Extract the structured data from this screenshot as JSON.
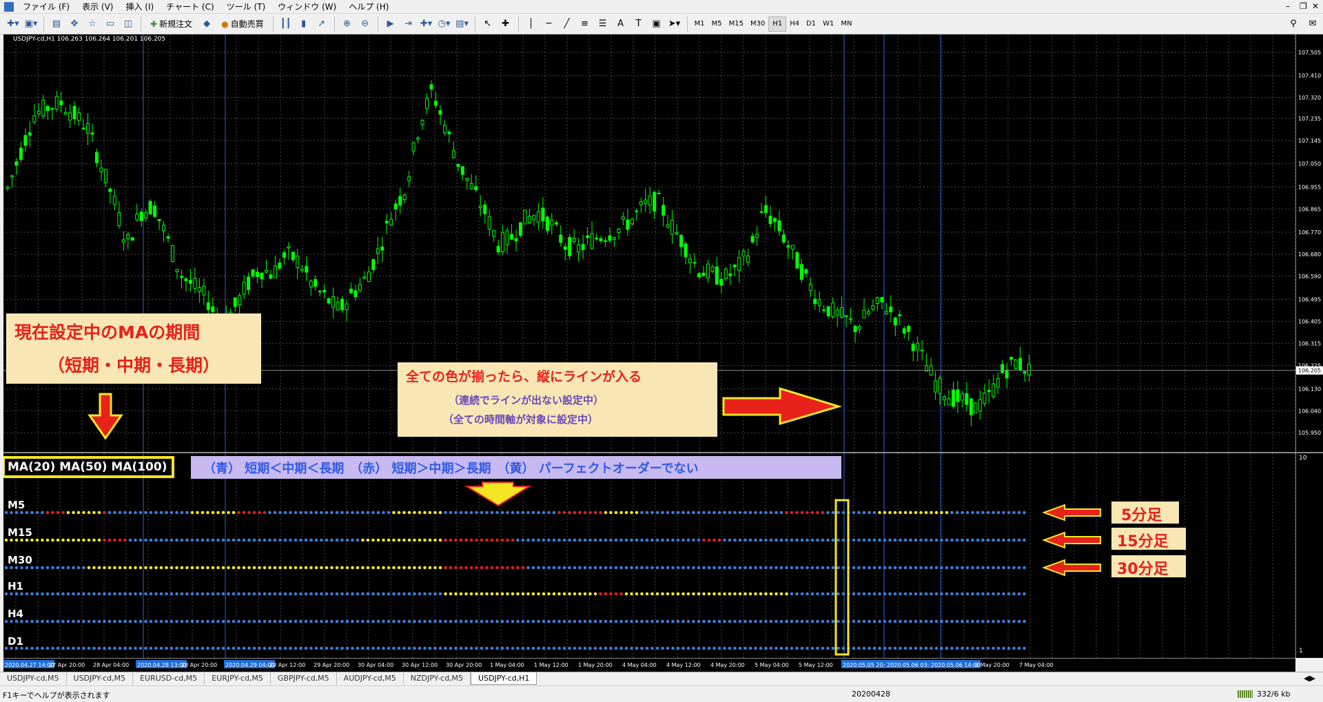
{
  "menu": [
    "ファイル (F)",
    "表示 (V)",
    "挿入 (I)",
    "チャート (C)",
    "ツール (T)",
    "ウィンドウ (W)",
    "ヘルプ (H)"
  ],
  "toolbar": {
    "new_order": "新規注文",
    "auto_trade": "自動売買",
    "timeframes": [
      "M1",
      "M5",
      "M15",
      "M30",
      "H1",
      "H4",
      "D1",
      "W1",
      "MN"
    ],
    "active_timeframe": "H1"
  },
  "chart": {
    "symbol_info": "USDJPY-cd,H1  106.263 106.264 106.201 106.205",
    "current_price": "106.205",
    "price_labels": [
      "107.505",
      "107.410",
      "107.320",
      "107.235",
      "107.145",
      "107.050",
      "106.955",
      "106.865",
      "106.770",
      "106.680",
      "106.590",
      "106.495",
      "106.405",
      "106.315",
      "106.225",
      "106.130",
      "106.040",
      "105.950"
    ],
    "sub_axis_labels": [
      "10",
      "1"
    ],
    "time_labels": [
      "2020.04.27 14:00",
      "27 Apr 20:00",
      "28 Apr 04:00",
      "2020.04.28 13:00",
      "28 Apr 20:00",
      "2020.04.29 04:00",
      "29 Apr 12:00",
      "29 Apr 20:00",
      "30 Apr 04:00",
      "30 Apr 12:00",
      "30 Apr 20:00",
      "1 May 04:00",
      "1 May 12:00",
      "1 May 20:00",
      "4 May 04:00",
      "4 May 12:00",
      "4 May 20:00",
      "5 May 04:00",
      "5 May 12:00",
      "2020.05.05 20:00",
      "2020.05.06 03:00",
      "2020.05.06 14:00",
      "6 May 20:00",
      "7 May 04:00"
    ],
    "colors": {
      "candle": "#00ff00",
      "blue_dot": "#3a7fdc",
      "red_dot": "#e0201a",
      "yellow_dot": "#f5e623",
      "annotation_bg": "#f8e7b4",
      "legend_bg": "#c8b9f0"
    }
  },
  "annotations": {
    "ma_period_title": "現在設定中のMAの期間",
    "ma_period_sub": "（短期・中期・長期）",
    "ma_values": "MA(20)  MA(50)  MA(100)",
    "color_legend": "（青） 短期＜中期＜長期　（赤） 短期＞中期＞長期　（黄） パーフェクトオーダーでない",
    "line_title": "全ての色が揃ったら、縦にラインが入る",
    "line_sub1": "（連続でラインが出ない設定中）",
    "line_sub2": "（全ての時間軸が対象に設定中）",
    "tf_labels": [
      "5分足",
      "15分足",
      "30分足"
    ]
  },
  "indicator_rows": [
    "M5",
    "M15",
    "M30",
    "H1",
    "H4",
    "D1"
  ],
  "tabs": [
    "USDJPY-cd,M5",
    "USDJPY-cd,M5",
    "EURUSD-cd,M5",
    "EURJPY-cd,M5",
    "GBPJPY-cd,M5",
    "AUDJPY-cd,M5",
    "NZDJPY-cd,M5",
    "USDJPY-cd,H1"
  ],
  "active_tab": 7,
  "status": {
    "help": "F1キーでヘルプが表示されます",
    "date": "20200428",
    "traffic": "332/6 kb"
  }
}
